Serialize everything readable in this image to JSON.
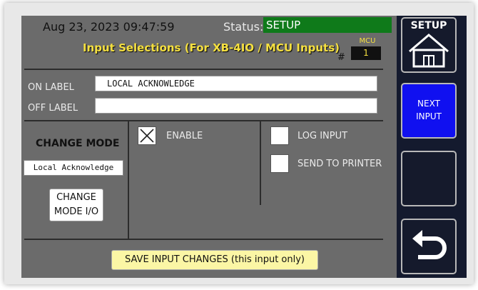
{
  "header": {
    "datetime": "Aug 23, 2023 09:47:59",
    "status_label": "Status:",
    "status_value": "SETUP",
    "title": "Input Selections (For XB-4IO / MCU Inputs)",
    "hash": "#",
    "mcu_label": "MCU",
    "mcu_value": "1"
  },
  "labels": {
    "on_label": "ON LABEL",
    "on_value": "LOCAL ACKNOWLEDGE",
    "off_label": "OFF LABEL",
    "off_value": ""
  },
  "mode": {
    "title": "CHANGE MODE",
    "current": "Local Acknowledge",
    "button_line1": "CHANGE",
    "button_line2": "MODE I/O"
  },
  "options": {
    "enable_label": "ENABLE",
    "enable_checked": true,
    "log_input_label": "LOG INPUT",
    "log_input_checked": false,
    "send_printer_label": "SEND TO PRINTER",
    "send_printer_checked": false
  },
  "save_button": "SAVE INPUT CHANGES (this input only)",
  "sidebar": {
    "setup_label": "SETUP",
    "next_line1": "NEXT",
    "next_line2": "INPUT",
    "icons": [
      "house-icon",
      "back-arrow-icon"
    ]
  },
  "colors": {
    "status_green": "#0f7a1a",
    "title_yellow": "#f5e040",
    "next_blue": "#1010f0",
    "panel_gray": "#6b6b6b",
    "sidebar_navy": "#141a2e",
    "save_yellow": "#fbf6a5"
  }
}
